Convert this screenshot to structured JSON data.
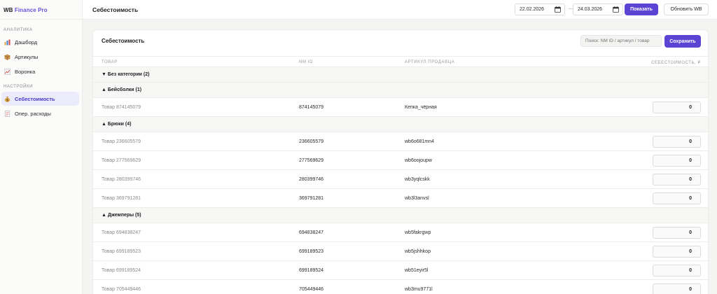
{
  "brand": {
    "prefix": "WB",
    "accent": "Finance Pro"
  },
  "sidebar": {
    "section1": "АНАЛИТИКА",
    "section2": "НАСТРОЙКИ",
    "items": [
      {
        "label": "Дашборд",
        "icon": "bar-chart-icon"
      },
      {
        "label": "Артикулы",
        "icon": "box-icon"
      },
      {
        "label": "Воронка",
        "icon": "trend-chart-icon"
      },
      {
        "label": "Себестоимость",
        "icon": "money-bag-icon",
        "active": true
      },
      {
        "label": "Опер. расходы",
        "icon": "document-icon"
      }
    ]
  },
  "topbar": {
    "title": "Себестоимость",
    "date_from": "22.02.2026",
    "date_sep": "—",
    "date_to": "24.03.2026",
    "show_label": "Показать",
    "refresh_label": "Обновить WB"
  },
  "card": {
    "title": "Себестоимость",
    "search_placeholder": "Поиск: NM ID / артикул / товар",
    "save_label": "Сохранить",
    "headers": {
      "product": "ТОВАР",
      "nm": "NM ID",
      "article": "АРТИКУЛ ПРОДАВЦА",
      "cost": "СЕБЕСТОИМОСТЬ, ₽"
    }
  },
  "rows": {
    "g0": "▼ Без категории (2)",
    "g1": "▲ Бейсболки (1)",
    "r1": {
      "name": "Товар 874145079",
      "nm": "874145079",
      "art": "Кепка_чёрная",
      "cost": "0"
    },
    "g2": "▲ Брюки (4)",
    "r2": {
      "name": "Товар 236605579",
      "nm": "236605579",
      "art": "wb6o681mn4",
      "cost": "0"
    },
    "r3": {
      "name": "Товар 277569629",
      "nm": "277569629",
      "art": "wb6oojoupw",
      "cost": "0"
    },
    "r4": {
      "name": "Товар 280399746",
      "nm": "280399746",
      "art": "wb3yqlcskk",
      "cost": "0"
    },
    "r5": {
      "name": "Товар 369791281",
      "nm": "369791281",
      "art": "wb3l3anvsl",
      "cost": "0"
    },
    "g3": "▲ Джемперы (5)",
    "r6": {
      "name": "Товар 694838247",
      "nm": "694838247",
      "art": "wb5fakrgwp",
      "cost": "0"
    },
    "r7": {
      "name": "Товар 699189523",
      "nm": "699189523",
      "art": "wb5jshhkop",
      "cost": "0"
    },
    "r8": {
      "name": "Товар 699189524",
      "nm": "699189524",
      "art": "wb51eyir5l",
      "cost": "0"
    },
    "r9": {
      "name": "Товар 705449446",
      "nm": "705449446",
      "art": "wb3mu9771l",
      "cost": "0"
    }
  },
  "colors": {
    "accent": "#5b44d4",
    "active_bg": "#ecebfb",
    "page_bg": "#f4f4f2"
  }
}
